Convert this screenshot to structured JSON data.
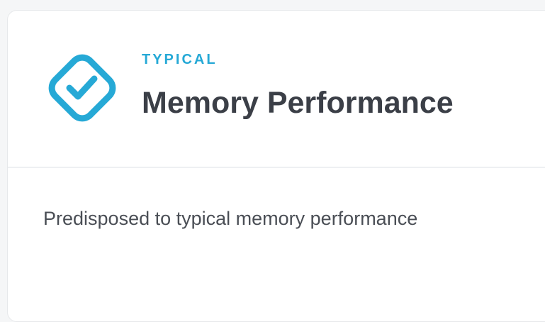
{
  "card": {
    "status_label": "TYPICAL",
    "title": "Memory Performance",
    "description": "Predisposed to typical memory performance",
    "icon": "checkmark-diamond-icon",
    "accent_color": "#26a9d6",
    "title_color": "#3b3f47"
  }
}
